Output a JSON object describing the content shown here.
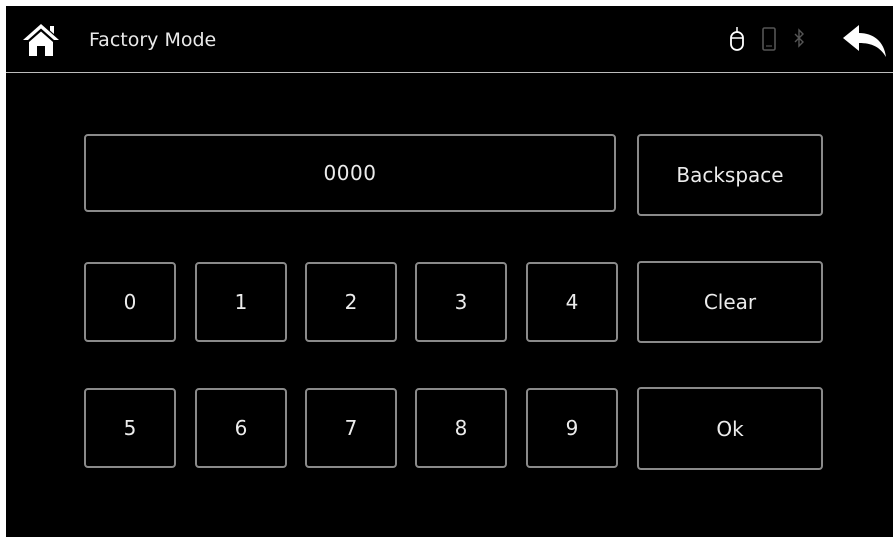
{
  "header": {
    "title": "Factory Mode",
    "icons": {
      "home": "home-icon",
      "mouse": "mouse-icon",
      "phone": "phone-icon",
      "bluetooth": "bluetooth-icon",
      "back": "back-arrow-icon"
    }
  },
  "keypad": {
    "display_value": "0000",
    "digits_row1": [
      "0",
      "1",
      "2",
      "3",
      "4"
    ],
    "digits_row2": [
      "5",
      "6",
      "7",
      "8",
      "9"
    ],
    "backspace_label": "Backspace",
    "clear_label": "Clear",
    "ok_label": "Ok"
  },
  "colors": {
    "background": "#000000",
    "border": "#8a8a8a",
    "text": "#ececec",
    "divider": "#bdbdbd"
  }
}
